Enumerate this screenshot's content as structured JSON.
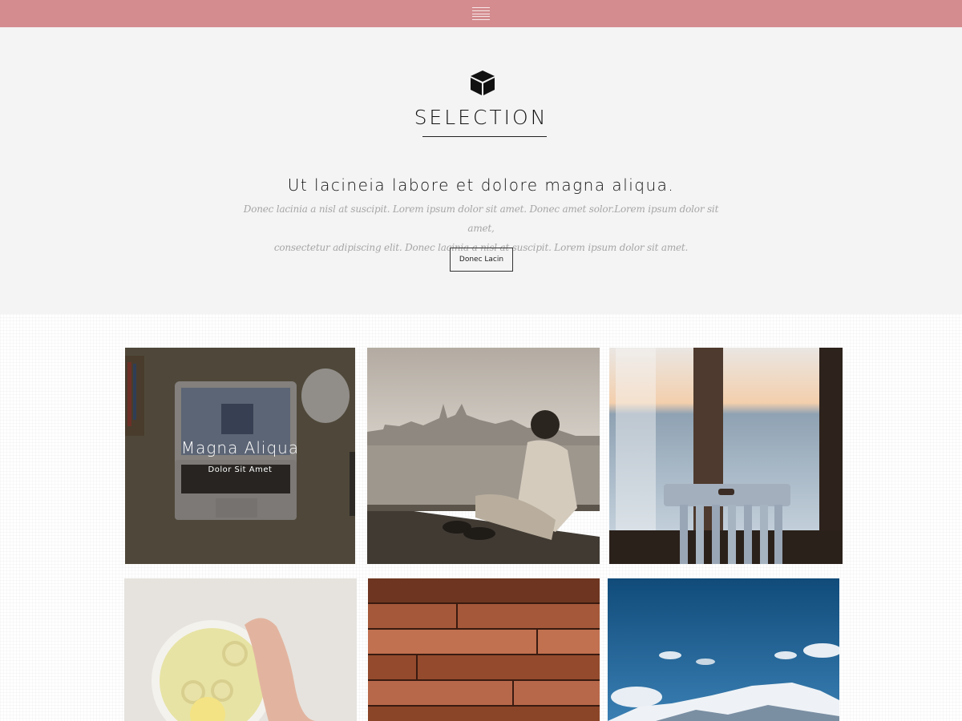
{
  "header": {
    "menu_icon": "hamburger-menu-icon"
  },
  "hero": {
    "icon": "cube-icon",
    "title": "SELECTION",
    "headline": "Ut lacineia labore et dolore magna aliqua.",
    "desc_line1": "Donec lacinia a nisl at suscipit. Lorem ipsum dolor sit amet. Donec amet solor.Lorem ipsum dolor sit amet,",
    "desc_line2": "consectetur adipiscing elit. Donec lacinia a nisl at suscipit. Lorem ipsum dolor sit amet.",
    "button_label": "Donec Lacin"
  },
  "gallery": {
    "items": [
      {
        "subject": "laptop-photo",
        "title": "Magna Aliqua",
        "subtitle": "Dolor Sit Amet"
      },
      {
        "subject": "man-by-sea-photo"
      },
      {
        "subject": "chair-window-photo"
      },
      {
        "subject": "lemon-tea-photo"
      },
      {
        "subject": "wood-planks-photo"
      },
      {
        "subject": "mountain-sky-photo"
      }
    ]
  },
  "colors": {
    "topbar": "#d48c8f",
    "hero_bg": "#f4f4f4"
  }
}
